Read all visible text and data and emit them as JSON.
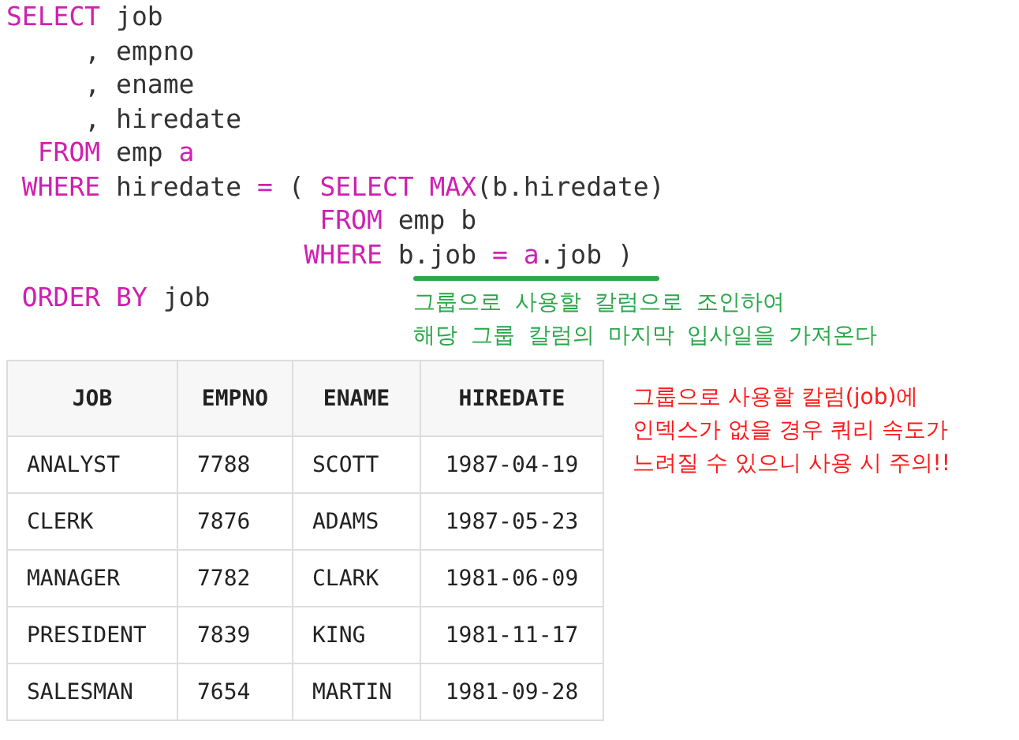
{
  "code": {
    "lines": [
      [
        {
          "kind": "keyword",
          "text": "SELECT"
        },
        {
          "kind": "plain",
          "text": " job"
        }
      ],
      [
        {
          "kind": "plain",
          "text": "     , empno"
        }
      ],
      [
        {
          "kind": "plain",
          "text": "     , ename"
        }
      ],
      [
        {
          "kind": "plain",
          "text": "     , hiredate"
        }
      ],
      [
        {
          "kind": "keyword",
          "text": "  FROM"
        },
        {
          "kind": "plain",
          "text": " emp "
        },
        {
          "kind": "keyword",
          "text": "a"
        }
      ],
      [
        {
          "kind": "keyword",
          "text": " WHERE"
        },
        {
          "kind": "plain",
          "text": " hiredate "
        },
        {
          "kind": "keyword",
          "text": "="
        },
        {
          "kind": "plain",
          "text": " ( "
        },
        {
          "kind": "keyword",
          "text": "SELECT MAX"
        },
        {
          "kind": "plain",
          "text": "(b.hiredate)"
        }
      ],
      [
        {
          "kind": "keyword",
          "text": "                    FROM"
        },
        {
          "kind": "plain",
          "text": " emp b"
        }
      ],
      [
        {
          "kind": "keyword",
          "text": "                   WHERE"
        },
        {
          "kind": "plain",
          "text": " b.job "
        },
        {
          "kind": "keyword",
          "text": "= a"
        },
        {
          "kind": "plain",
          "text": ".job )"
        }
      ],
      [
        {
          "kind": "keyword",
          "text": " ORDER BY"
        },
        {
          "kind": "plain",
          "text": " job"
        }
      ]
    ]
  },
  "annotation": {
    "lines": [
      "그룹으로 사용할 칼럼으로 조인하여",
      "해당 그룹 칼럼의 마지막 입사일을 가져온다"
    ]
  },
  "table": {
    "columns": [
      "JOB",
      "EMPNO",
      "ENAME",
      "HIREDATE"
    ],
    "rows": [
      [
        "ANALYST",
        "7788",
        "SCOTT",
        "1987-04-19"
      ],
      [
        "CLERK",
        "7876",
        "ADAMS",
        "1987-05-23"
      ],
      [
        "MANAGER",
        "7782",
        "CLARK",
        "1981-06-09"
      ],
      [
        "PRESIDENT",
        "7839",
        "KING",
        "1981-11-17"
      ],
      [
        "SALESMAN",
        "7654",
        "MARTIN",
        "1981-09-28"
      ]
    ]
  },
  "warning": {
    "lines": [
      "그룹으로 사용할 칼럼(job)에",
      "인덱스가 없을 경우 쿼리 속도가",
      "느려질 수 있으니 사용 시 주의!!"
    ]
  }
}
